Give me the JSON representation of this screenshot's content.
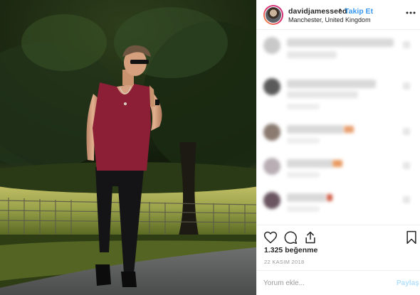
{
  "post": {
    "username": "davidjamesseed",
    "separator": "•",
    "follow_label": "Takip Et",
    "location": "Manchester, United Kingdom",
    "likes_text": "1.325 beğenme",
    "date_text": "22 KASIM 2018"
  },
  "comment_input": {
    "placeholder": "Yorum ekle...",
    "post_label": "Paylaş"
  },
  "icons": {
    "more": "more-options-icon",
    "like": "heart-icon",
    "comment": "comment-bubble-icon",
    "share": "share-icon",
    "save": "bookmark-icon"
  },
  "colors": {
    "link_blue": "#3897f0",
    "post_button_disabled": "#b2dffc",
    "shirt": "#8c1f35"
  }
}
